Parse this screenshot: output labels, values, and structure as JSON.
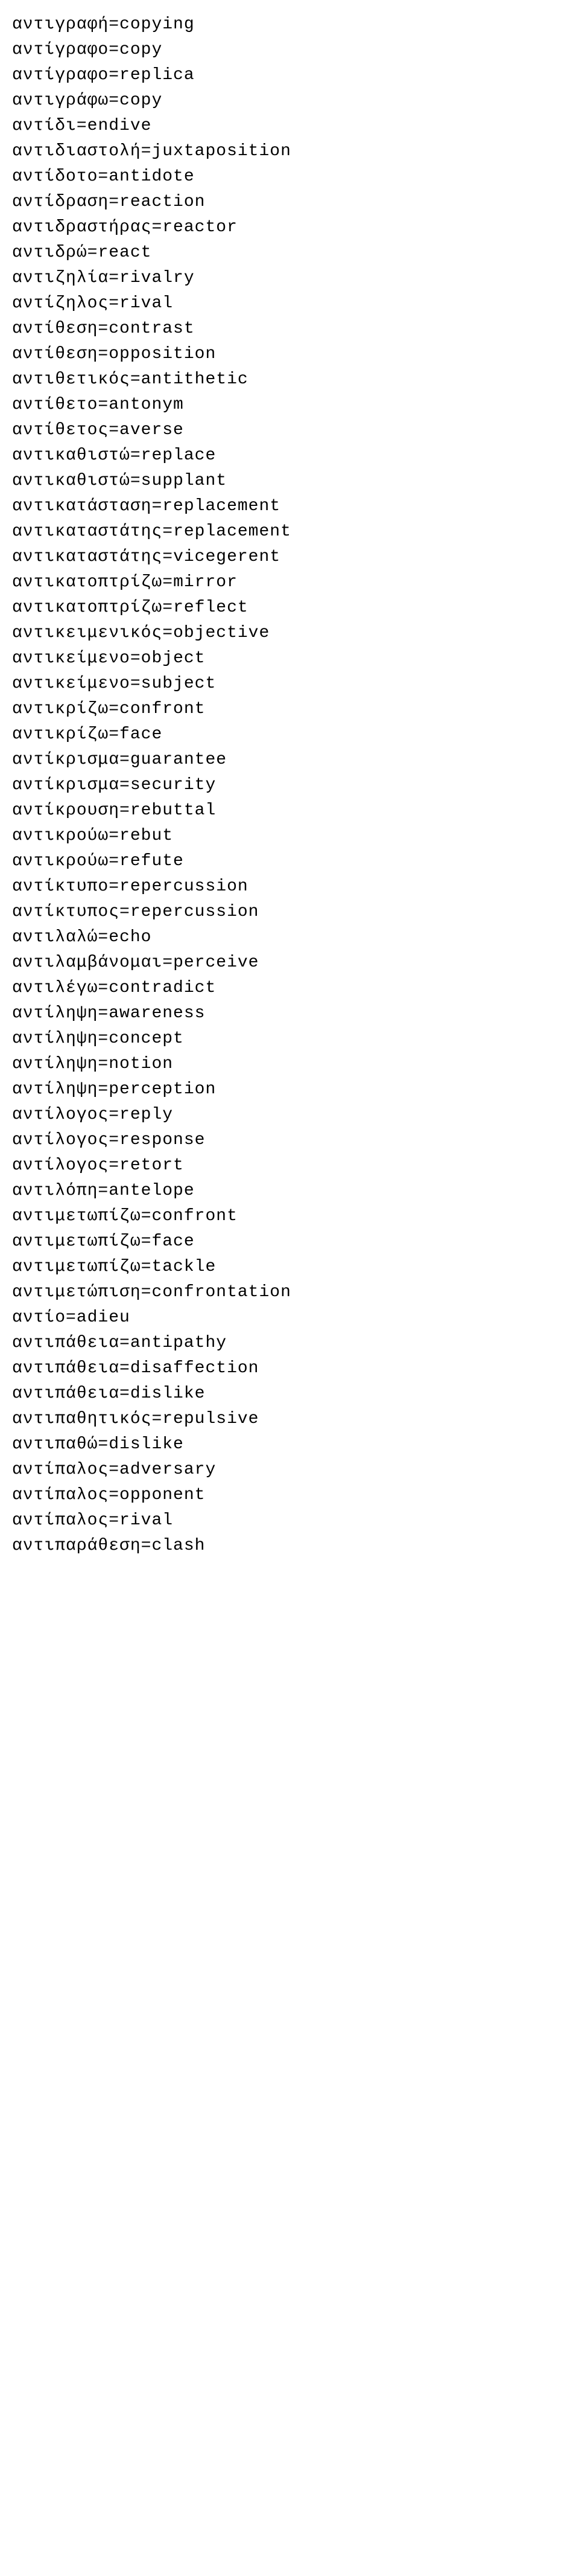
{
  "entries": [
    {
      "greek": "αντιγραφή",
      "english": "copying"
    },
    {
      "greek": "αντίγραφο",
      "english": "copy"
    },
    {
      "greek": "αντίγραφο",
      "english": "replica"
    },
    {
      "greek": "αντιγράφω",
      "english": "copy"
    },
    {
      "greek": "αντίδι",
      "english": "endive"
    },
    {
      "greek": "αντιδιαστολή",
      "english": "juxtaposition"
    },
    {
      "greek": "αντίδοτο",
      "english": "antidote"
    },
    {
      "greek": "αντίδραση",
      "english": "reaction"
    },
    {
      "greek": "αντιδραστήρας",
      "english": "reactor"
    },
    {
      "greek": "αντιδρώ",
      "english": "react"
    },
    {
      "greek": "αντιζηλία",
      "english": "rivalry"
    },
    {
      "greek": "αντίζηλος",
      "english": "rival"
    },
    {
      "greek": "αντίθεση",
      "english": "contrast"
    },
    {
      "greek": "αντίθεση",
      "english": "opposition"
    },
    {
      "greek": "αντιθετικός",
      "english": "antithetic"
    },
    {
      "greek": "αντίθετο",
      "english": "antonym"
    },
    {
      "greek": "αντίθετος",
      "english": "averse"
    },
    {
      "greek": "αντικαθιστώ",
      "english": "replace"
    },
    {
      "greek": "αντικαθιστώ",
      "english": "supplant"
    },
    {
      "greek": "αντικατάσταση",
      "english": "replacement"
    },
    {
      "greek": "αντικαταστάτης",
      "english": "replacement"
    },
    {
      "greek": "αντικαταστάτης",
      "english": "vicegerent"
    },
    {
      "greek": "αντικατοπτρίζω",
      "english": "mirror"
    },
    {
      "greek": "αντικατοπτρίζω",
      "english": "reflect"
    },
    {
      "greek": "αντικειμενικός",
      "english": "objective"
    },
    {
      "greek": "αντικείμενο",
      "english": "object"
    },
    {
      "greek": "αντικείμενο",
      "english": "subject"
    },
    {
      "greek": "αντικρίζω",
      "english": "confront"
    },
    {
      "greek": "αντικρίζω",
      "english": "face"
    },
    {
      "greek": "αντίκρισμα",
      "english": "guarantee"
    },
    {
      "greek": "αντίκρισμα",
      "english": "security"
    },
    {
      "greek": "αντίκρουση",
      "english": "rebuttal"
    },
    {
      "greek": "αντικρούω",
      "english": "rebut"
    },
    {
      "greek": "αντικρούω",
      "english": "refute"
    },
    {
      "greek": "αντίκτυπο",
      "english": "repercussion"
    },
    {
      "greek": "αντίκτυπος",
      "english": "repercussion"
    },
    {
      "greek": "αντιλαλώ",
      "english": "echo"
    },
    {
      "greek": "αντιλαμβάνομαι",
      "english": "perceive"
    },
    {
      "greek": "αντιλέγω",
      "english": "contradict"
    },
    {
      "greek": "αντίληψη",
      "english": "awareness"
    },
    {
      "greek": "αντίληψη",
      "english": "concept"
    },
    {
      "greek": "αντίληψη",
      "english": "notion"
    },
    {
      "greek": "αντίληψη",
      "english": "perception"
    },
    {
      "greek": "αντίλογος",
      "english": "reply"
    },
    {
      "greek": "αντίλογος",
      "english": "response"
    },
    {
      "greek": "αντίλογος",
      "english": "retort"
    },
    {
      "greek": "αντιλόπη",
      "english": "antelope"
    },
    {
      "greek": "αντιμετωπίζω",
      "english": "confront"
    },
    {
      "greek": "αντιμετωπίζω",
      "english": "face"
    },
    {
      "greek": "αντιμετωπίζω",
      "english": "tackle"
    },
    {
      "greek": "αντιμετώπιση",
      "english": "confrontation"
    },
    {
      "greek": "αντίο",
      "english": "adieu"
    },
    {
      "greek": "αντιπάθεια",
      "english": "antipathy"
    },
    {
      "greek": "αντιπάθεια",
      "english": "disaffection"
    },
    {
      "greek": "αντιπάθεια",
      "english": "dislike"
    },
    {
      "greek": "αντιπαθητικός",
      "english": "repulsive"
    },
    {
      "greek": "αντιπαθώ",
      "english": "dislike"
    },
    {
      "greek": "αντίπαλος",
      "english": "adversary"
    },
    {
      "greek": "αντίπαλος",
      "english": "opponent"
    },
    {
      "greek": "αντίπαλος",
      "english": "rival"
    },
    {
      "greek": "αντιπαράθεση",
      "english": "clash"
    }
  ]
}
